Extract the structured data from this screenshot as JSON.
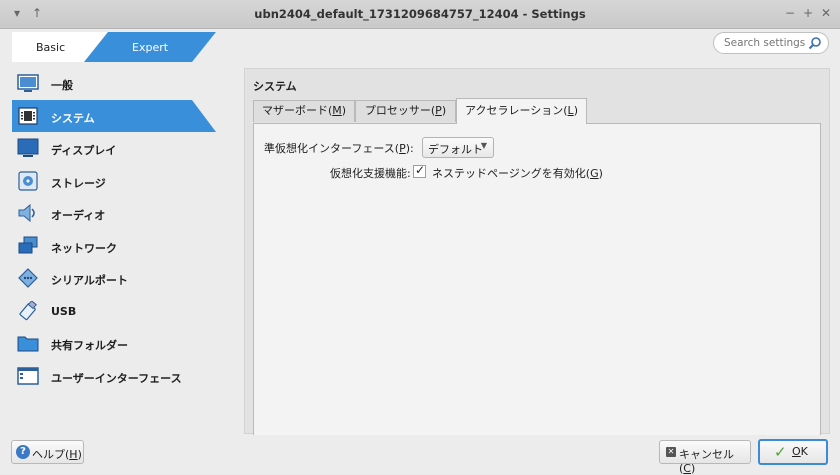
{
  "window": {
    "title": "ubn2404_default_1731209684757_12404 - Settings",
    "menu_glyph": "▾",
    "pin_glyph": "↑",
    "minimize_glyph": "−",
    "maximize_glyph": "+",
    "close_glyph": "✕"
  },
  "mode": {
    "basic_label": "Basic",
    "expert_label": "Expert",
    "active": "Expert"
  },
  "search": {
    "placeholder": "Search settings"
  },
  "sidebar": {
    "items": [
      {
        "label": "一般",
        "icon": "general-icon"
      },
      {
        "label": "システム",
        "icon": "system-icon",
        "active": true
      },
      {
        "label": "ディスプレイ",
        "icon": "display-icon"
      },
      {
        "label": "ストレージ",
        "icon": "storage-icon"
      },
      {
        "label": "オーディオ",
        "icon": "audio-icon"
      },
      {
        "label": "ネットワーク",
        "icon": "network-icon"
      },
      {
        "label": "シリアルポート",
        "icon": "serial-port-icon"
      },
      {
        "label": "USB",
        "icon": "usb-icon"
      },
      {
        "label": "共有フォルダー",
        "icon": "shared-folder-icon"
      },
      {
        "label": "ユーザーインターフェース",
        "icon": "user-interface-icon"
      }
    ]
  },
  "panel": {
    "title": "システム",
    "tabs": [
      {
        "label": "マザーボード(",
        "mnemonic": "M",
        "suffix": ")"
      },
      {
        "label": "プロセッサー(",
        "mnemonic": "P",
        "suffix": ")"
      },
      {
        "label": "アクセラレーション(",
        "mnemonic": "L",
        "suffix": ")",
        "active": true
      }
    ],
    "paravirt": {
      "label": "準仮想化インターフェース(",
      "mnemonic": "P",
      "suffix": "):",
      "value": "デフォルト"
    },
    "hwvirt": {
      "label": "仮想化支援機能:",
      "checkbox_label": "ネステッドページングを有効化(",
      "mnemonic": "G",
      "suffix": ")",
      "checked": true,
      "check_glyph": "✓"
    }
  },
  "buttons": {
    "help": {
      "label": "ヘルプ(",
      "mnemonic": "H",
      "suffix": ")",
      "q_glyph": "?"
    },
    "cancel": {
      "label": "キャンセル(",
      "mnemonic": "C",
      "suffix": ")",
      "x_glyph": "✕"
    },
    "ok": {
      "mnemonic": "O",
      "suffix": "K",
      "check_glyph": "✓"
    }
  },
  "colors": {
    "accent": "#3a8fdb",
    "ok_border": "#3c8ad8"
  }
}
